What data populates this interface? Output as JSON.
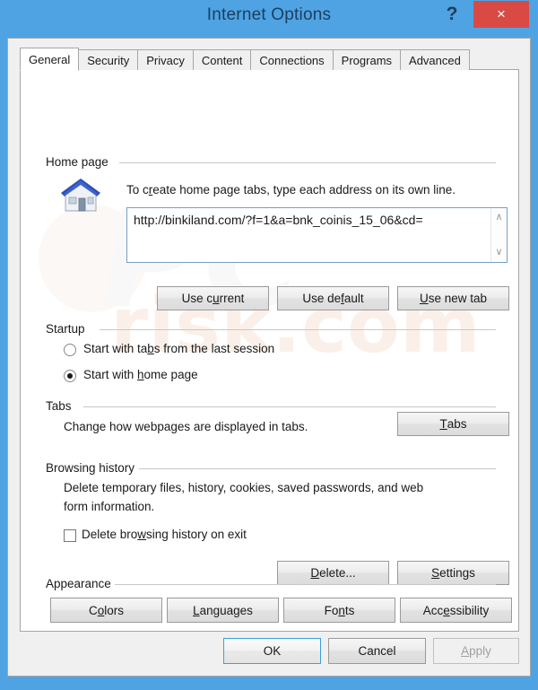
{
  "window": {
    "title": "Internet Options",
    "help_label": "?",
    "close_label": "×",
    "titlebar_color": "#4fa3e3",
    "close_color": "#d94a45"
  },
  "tabs": [
    {
      "label": "General",
      "active": true
    },
    {
      "label": "Security",
      "active": false
    },
    {
      "label": "Privacy",
      "active": false
    },
    {
      "label": "Content",
      "active": false
    },
    {
      "label": "Connections",
      "active": false
    },
    {
      "label": "Programs",
      "active": false
    },
    {
      "label": "Advanced",
      "active": false
    }
  ],
  "home_page": {
    "group_label": "Home page",
    "icon": "house-icon",
    "description_pre": "To c",
    "description_accel": "r",
    "description_post": "eate home page tabs, type each address on its own line.",
    "url_value": "http://binkiland.com/?f=1&a=bnk_coinis_15_06&cd=",
    "scroll_up": "∧",
    "scroll_down": "∨",
    "buttons": [
      {
        "pre": "Use c",
        "accel": "u",
        "post": "rrent"
      },
      {
        "pre": "Use de",
        "accel": "f",
        "post": "ault"
      },
      {
        "pre": "",
        "accel": "U",
        "post": "se new tab"
      }
    ]
  },
  "startup": {
    "group_label": "Startup",
    "options": [
      {
        "pre": "Start with ta",
        "accel": "b",
        "post": "s from the last session",
        "selected": false
      },
      {
        "pre": "Start with ",
        "accel": "h",
        "post": "ome page",
        "selected": true
      }
    ]
  },
  "tabs_section": {
    "group_label": "Tabs",
    "description": "Change how webpages are displayed in tabs.",
    "button": {
      "pre": "",
      "accel": "T",
      "post": "abs"
    }
  },
  "browsing_history": {
    "group_label": "Browsing history",
    "description_line1": "Delete temporary files, history, cookies, saved passwords, and web",
    "description_line2": "form information.",
    "checkbox": {
      "pre": "Delete bro",
      "accel": "w",
      "post": "sing history on exit",
      "checked": false
    },
    "buttons": [
      {
        "pre": "",
        "accel": "D",
        "post": "elete..."
      },
      {
        "pre": "",
        "accel": "S",
        "post": "ettings"
      }
    ]
  },
  "appearance": {
    "group_label": "Appearance",
    "buttons": [
      {
        "pre": "C",
        "accel": "o",
        "post": "lors"
      },
      {
        "pre": "",
        "accel": "L",
        "post": "anguages"
      },
      {
        "pre": "Fo",
        "accel": "n",
        "post": "ts"
      },
      {
        "pre": "Acc",
        "accel": "e",
        "post": "ssibility"
      }
    ]
  },
  "footer": {
    "ok": "OK",
    "cancel": "Cancel",
    "apply_pre": "",
    "apply_accel": "A",
    "apply_post": "pply",
    "apply_disabled": true
  },
  "watermark": {
    "text_top": "PC",
    "text_bottom": "risk.com"
  }
}
